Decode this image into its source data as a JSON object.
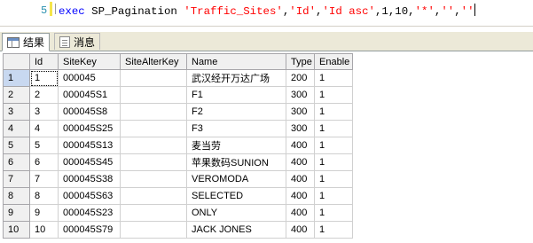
{
  "editor": {
    "line_number": "5",
    "code": {
      "kw": "exec",
      "proc": " SP_Pagination ",
      "s1": "'Traffic_Sites'",
      "c1": ",",
      "s2": "'Id'",
      "c2": ",",
      "s3": "'Id asc'",
      "nums": ",1,10,",
      "s4": "'*'",
      "c3": ",",
      "s5": "''",
      "c4": ",",
      "s6": "''"
    }
  },
  "tabs": {
    "results": "结果",
    "messages": "消息"
  },
  "table": {
    "columns": [
      "",
      "Id",
      "SiteKey",
      "SiteAlterKey",
      "Name",
      "Type",
      "Enable"
    ],
    "rows": [
      [
        "1",
        "1",
        "000045",
        "",
        "武汉经开万达广场",
        "200",
        "1"
      ],
      [
        "2",
        "2",
        "000045S1",
        "",
        "F1",
        "300",
        "1"
      ],
      [
        "3",
        "3",
        "000045S8",
        "",
        "F2",
        "300",
        "1"
      ],
      [
        "4",
        "4",
        "000045S25",
        "",
        "F3",
        "300",
        "1"
      ],
      [
        "5",
        "5",
        "000045S13",
        "",
        "麦当劳",
        "400",
        "1"
      ],
      [
        "6",
        "6",
        "000045S45",
        "",
        "苹果数码SUNION",
        "400",
        "1"
      ],
      [
        "7",
        "7",
        "000045S38",
        "",
        "VEROMODA",
        "400",
        "1"
      ],
      [
        "8",
        "8",
        "000045S63",
        "",
        "SELECTED",
        "400",
        "1"
      ],
      [
        "9",
        "9",
        "000045S23",
        "",
        "ONLY",
        "400",
        "1"
      ],
      [
        "10",
        "10",
        "000045S79",
        "",
        "JACK JONES",
        "400",
        "1"
      ]
    ]
  }
}
